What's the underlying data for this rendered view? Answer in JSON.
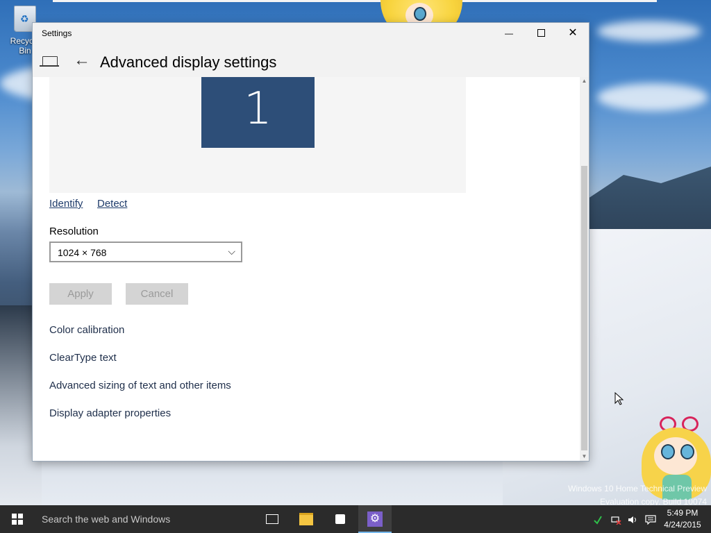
{
  "desktop": {
    "recycle_bin_label": "Recycle Bin",
    "watermark_line1": "Windows 10 Home Technical Preview",
    "watermark_line2": "Evaluation copy. Build 10074"
  },
  "window": {
    "title": "Settings",
    "minimize_glyph": "—",
    "close_glyph": "✕",
    "back_glyph": "←",
    "page_title": "Advanced display settings"
  },
  "display": {
    "monitor_number": "1",
    "identify_label": "Identify",
    "detect_label": "Detect",
    "resolution_label": "Resolution",
    "resolution_value": "1024 × 768",
    "dropdown_glyph": "⌵",
    "apply_label": "Apply",
    "cancel_label": "Cancel"
  },
  "related": [
    {
      "label": "Color calibration"
    },
    {
      "label": "ClearType text"
    },
    {
      "label": "Advanced sizing of text and other items"
    },
    {
      "label": "Display adapter properties"
    }
  ],
  "taskbar": {
    "search_placeholder": "Search the web and Windows",
    "settings_glyph": "⚙",
    "clock_time": "5:49 PM",
    "clock_date": "4/24/2015"
  },
  "icons": {
    "tray": [
      "shield-check-icon",
      "network-disconnected-icon",
      "volume-icon",
      "action-center-icon"
    ]
  }
}
